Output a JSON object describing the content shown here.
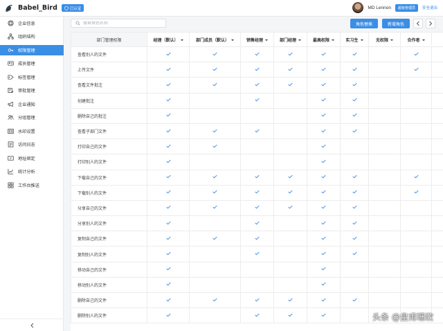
{
  "header": {
    "brand": "Babel_Bird",
    "verify_badge": "已认证",
    "user_name": "MD Lennon",
    "role_badge": "超级管理员",
    "logout": "安全退出"
  },
  "sidebar": {
    "items": [
      {
        "label": "企业信息",
        "icon": "building-icon"
      },
      {
        "label": "组织结构",
        "icon": "org-chart-icon"
      },
      {
        "label": "权限管理",
        "icon": "key-icon",
        "active": true
      },
      {
        "label": "成员管理",
        "icon": "id-card-icon"
      },
      {
        "label": "标签管理",
        "icon": "tag-icon"
      },
      {
        "label": "审批管理",
        "icon": "approval-icon"
      },
      {
        "label": "企业通知",
        "icon": "megaphone-icon"
      },
      {
        "label": "分组管理",
        "icon": "group-icon"
      },
      {
        "label": "水印设置",
        "icon": "watermark-icon"
      },
      {
        "label": "访问日志",
        "icon": "log-icon"
      },
      {
        "label": "地址绑定",
        "icon": "ip-address-icon"
      },
      {
        "label": "统计分析",
        "icon": "stats-icon"
      },
      {
        "label": "工作台推送",
        "icon": "push-icon"
      }
    ]
  },
  "toolbar": {
    "search_placeholder": "搜索角色名称",
    "replace_role": "角色替换",
    "add_role": "新增角色"
  },
  "table": {
    "first_header": "部门管理权限",
    "columns": [
      "经理（默认）",
      "部门成员（默认）",
      "销售经理",
      "部门经理",
      "最高权限",
      "实习生",
      "无权限",
      "合作者",
      "测"
    ],
    "rows": [
      {
        "label": "查看别人的文件",
        "checks": [
          1,
          1,
          1,
          1,
          1,
          1,
          0,
          1,
          0
        ]
      },
      {
        "label": "上传文件",
        "checks": [
          1,
          1,
          1,
          1,
          1,
          1,
          0,
          1,
          0
        ]
      },
      {
        "label": "查看文件批注",
        "checks": [
          1,
          1,
          1,
          1,
          1,
          1,
          0,
          0,
          0
        ]
      },
      {
        "label": "创建批注",
        "checks": [
          1,
          0,
          1,
          0,
          1,
          1,
          0,
          0,
          0
        ]
      },
      {
        "label": "删除自己的批注",
        "checks": [
          1,
          0,
          0,
          0,
          1,
          1,
          0,
          0,
          0
        ]
      },
      {
        "label": "查看子部门文件",
        "checks": [
          1,
          1,
          1,
          0,
          1,
          1,
          0,
          0,
          0
        ]
      },
      {
        "label": "打印自己的文件",
        "checks": [
          1,
          1,
          0,
          0,
          1,
          0,
          0,
          0,
          0
        ]
      },
      {
        "label": "打印别人的文件",
        "checks": [
          1,
          0,
          0,
          0,
          1,
          0,
          0,
          0,
          0
        ]
      },
      {
        "label": "下载自己的文件",
        "checks": [
          1,
          1,
          1,
          1,
          1,
          1,
          0,
          1,
          0
        ]
      },
      {
        "label": "下载别人的文件",
        "checks": [
          1,
          1,
          1,
          1,
          1,
          1,
          0,
          1,
          0
        ]
      },
      {
        "label": "分享自己的文件",
        "checks": [
          1,
          1,
          1,
          1,
          1,
          1,
          0,
          0,
          0
        ]
      },
      {
        "label": "分享别人的文件",
        "checks": [
          1,
          0,
          1,
          0,
          1,
          1,
          0,
          0,
          0
        ]
      },
      {
        "label": "复制自己的文件",
        "checks": [
          1,
          1,
          1,
          0,
          1,
          1,
          0,
          0,
          0
        ]
      },
      {
        "label": "复制别人的文件",
        "checks": [
          1,
          0,
          1,
          0,
          1,
          1,
          0,
          0,
          0
        ]
      },
      {
        "label": "移动自己的文件",
        "checks": [
          1,
          0,
          0,
          0,
          1,
          0,
          0,
          0,
          0
        ]
      },
      {
        "label": "移动别人的文件",
        "checks": [
          1,
          0,
          0,
          0,
          1,
          0,
          0,
          0,
          0
        ]
      },
      {
        "label": "删除自己的文件",
        "checks": [
          1,
          1,
          1,
          1,
          1,
          1,
          0,
          0,
          0
        ]
      },
      {
        "label": "删除别人的文件",
        "checks": [
          1,
          0,
          1,
          1,
          1,
          0,
          0,
          0,
          0
        ]
      }
    ]
  },
  "watermark": "头条 @皇甫珊欣",
  "colors": {
    "accent": "#3a8ee6",
    "check": "#3a8ee6"
  }
}
